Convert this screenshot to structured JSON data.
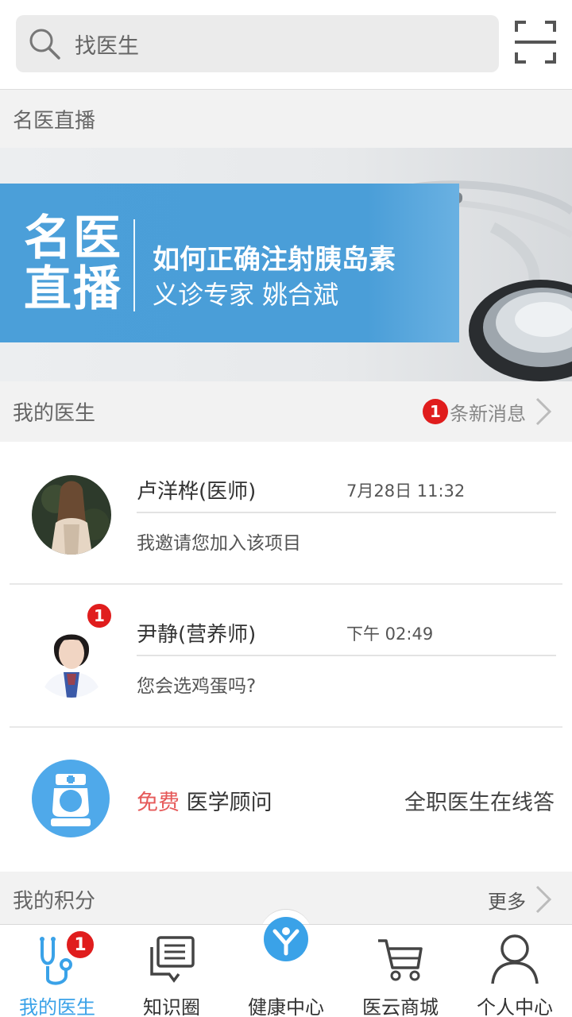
{
  "search": {
    "placeholder": "找医生"
  },
  "live": {
    "section_title": "名医直播",
    "banner": {
      "big_text_1": "名医",
      "big_text_2": "直播",
      "headline": "如何正确注射胰岛素",
      "subline": "义诊专家  姚合斌"
    }
  },
  "my_doctors": {
    "section_title": "我的医生",
    "new_count": "1",
    "new_label": "条新消息",
    "items": [
      {
        "name": "卢洋桦(医师)",
        "time": "7月28日 11:32",
        "message": "我邀请您加入该项目",
        "badge": ""
      },
      {
        "name": "尹静(营养师)",
        "time": "下午 02:49",
        "message": "您会选鸡蛋吗?",
        "badge": "1"
      }
    ],
    "advisor": {
      "free": "免费",
      "label": " 医学顾问",
      "right": "全职医生在线答"
    }
  },
  "points": {
    "section_title": "我的积分",
    "more": "更多"
  },
  "tabs": [
    {
      "label": "我的医生",
      "icon": "stethoscope-icon",
      "badge": "1"
    },
    {
      "label": "知识圈",
      "icon": "chat-bubble-icon"
    },
    {
      "label": "健康中心",
      "icon": "health-center-icon"
    },
    {
      "label": "医云商城",
      "icon": "cart-icon"
    },
    {
      "label": "个人中心",
      "icon": "person-icon"
    }
  ],
  "colors": {
    "accent": "#3aa2e8",
    "badge": "#e01d1d",
    "free": "#e65a5a",
    "banner_blue": "#4b9fd9"
  }
}
